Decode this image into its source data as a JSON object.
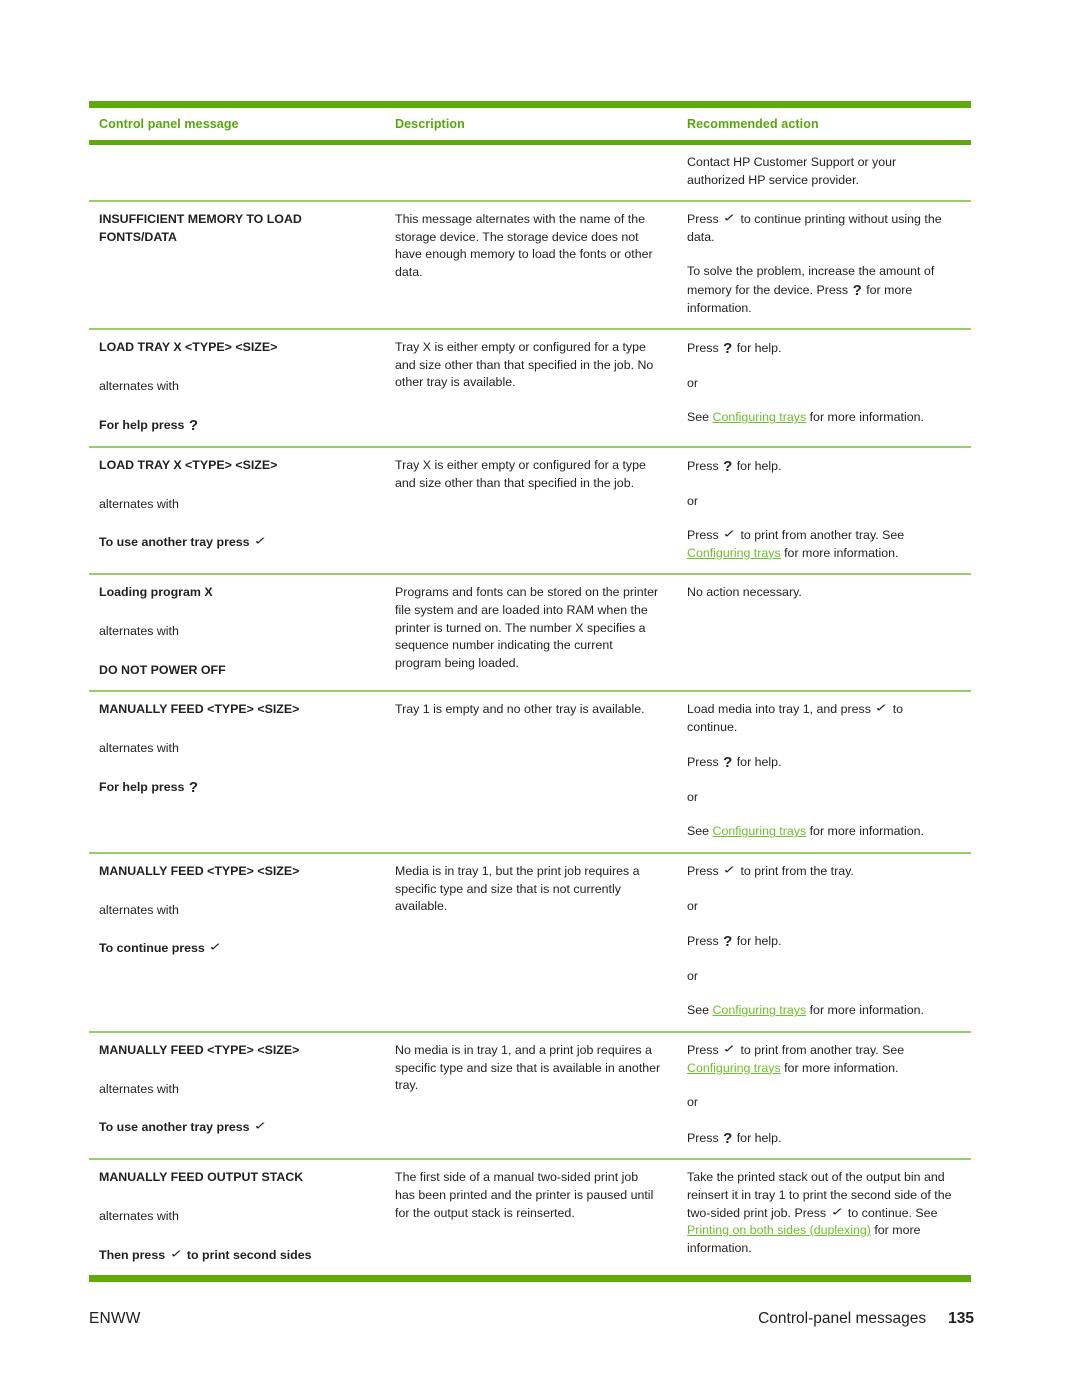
{
  "page": {
    "footer_left": "ENWW",
    "footer_section": "Control-panel messages",
    "footer_page_number": "135"
  },
  "colors": {
    "accent_green": "#5eaa0c",
    "header_text_green": "#58a60c",
    "row_rule_green": "#97cd6b",
    "link_green": "#6fbf2a",
    "body_text": "#231f20"
  },
  "glyphs": {
    "check": "✓",
    "question": "?"
  },
  "table": {
    "headers": {
      "col1": "Control panel message",
      "col2": "Description",
      "col3": "Recommended action"
    },
    "rows": [
      {
        "message_main": "",
        "alternates_label": "",
        "message_second": "",
        "description": [],
        "action": [
          {
            "parts": [
              {
                "t": "Contact HP Customer Support or your authorized HP service provider."
              }
            ]
          }
        ]
      },
      {
        "message_main": "INSUFFICIENT MEMORY TO LOAD FONTS/DATA",
        "alternates_label": "",
        "message_second": "",
        "description": [
          "This message alternates with the name of the storage device. The storage device does not have enough memory to load the fonts or other data."
        ],
        "action": [
          {
            "parts": [
              {
                "t": "Press "
              },
              {
                "icon": "check"
              },
              {
                "t": " to continue printing without using the data."
              }
            ]
          },
          {
            "parts": [
              {
                "t": "To solve the problem, increase the amount of memory for the device. Press "
              },
              {
                "icon": "question"
              },
              {
                "t": " for more information."
              }
            ]
          }
        ]
      },
      {
        "message_main": "LOAD TRAY X <TYPE> <SIZE>",
        "alternates_label": "alternates with",
        "message_second": "For help press ",
        "message_second_icon": "question",
        "description": [
          "Tray X is either empty or configured for a type and size other than that specified in the job. No other tray is available."
        ],
        "action": [
          {
            "parts": [
              {
                "t": "Press "
              },
              {
                "icon": "question"
              },
              {
                "t": " for help."
              }
            ]
          },
          {
            "parts": [
              {
                "t": "or"
              }
            ]
          },
          {
            "parts": [
              {
                "t": "See "
              },
              {
                "link": "Configuring trays"
              },
              {
                "t": " for more information."
              }
            ]
          }
        ]
      },
      {
        "message_main": "LOAD TRAY X <TYPE> <SIZE>",
        "alternates_label": "alternates with",
        "message_second": "To use another tray press ",
        "message_second_icon": "check",
        "description": [
          "Tray X is either empty or configured for a type and size other than that specified in the job."
        ],
        "action": [
          {
            "parts": [
              {
                "t": "Press "
              },
              {
                "icon": "question"
              },
              {
                "t": " for help."
              }
            ]
          },
          {
            "parts": [
              {
                "t": "or"
              }
            ]
          },
          {
            "parts": [
              {
                "t": "Press "
              },
              {
                "icon": "check"
              },
              {
                "t": " to print from another tray. See "
              },
              {
                "link": "Configuring trays"
              },
              {
                "t": " for more information."
              }
            ]
          }
        ]
      },
      {
        "message_main": "Loading program X",
        "alternates_label": "alternates with",
        "message_second": "DO NOT POWER OFF",
        "description": [
          "Programs and fonts can be stored on the printer file system and are loaded into RAM when the printer is turned on. The number X specifies a sequence number indicating the current program being loaded."
        ],
        "action": [
          {
            "parts": [
              {
                "t": "No action necessary."
              }
            ]
          }
        ]
      },
      {
        "message_main": "MANUALLY FEED <TYPE> <SIZE>",
        "alternates_label": "alternates with",
        "message_second": "For help press ",
        "message_second_icon": "question",
        "description": [
          "Tray 1 is empty and no other tray is available."
        ],
        "action": [
          {
            "parts": [
              {
                "t": "Load media into tray 1, and press "
              },
              {
                "icon": "check"
              },
              {
                "t": " to continue."
              }
            ]
          },
          {
            "parts": [
              {
                "t": "Press "
              },
              {
                "icon": "question"
              },
              {
                "t": " for help."
              }
            ]
          },
          {
            "parts": [
              {
                "t": "or"
              }
            ]
          },
          {
            "parts": [
              {
                "t": "See "
              },
              {
                "link": "Configuring trays"
              },
              {
                "t": " for more information."
              }
            ]
          }
        ]
      },
      {
        "message_main": "MANUALLY FEED <TYPE> <SIZE>",
        "alternates_label": "alternates with",
        "message_second": "To continue press ",
        "message_second_icon": "check",
        "description": [
          "Media is in tray 1, but the print job requires a specific type and size that is not currently available."
        ],
        "action": [
          {
            "parts": [
              {
                "t": "Press "
              },
              {
                "icon": "check"
              },
              {
                "t": " to print from the tray."
              }
            ]
          },
          {
            "parts": [
              {
                "t": "or"
              }
            ]
          },
          {
            "parts": [
              {
                "t": "Press "
              },
              {
                "icon": "question"
              },
              {
                "t": " for help."
              }
            ]
          },
          {
            "parts": [
              {
                "t": "or"
              }
            ]
          },
          {
            "parts": [
              {
                "t": "See "
              },
              {
                "link": "Configuring trays"
              },
              {
                "t": " for more information."
              }
            ]
          }
        ]
      },
      {
        "message_main": "MANUALLY FEED <TYPE> <SIZE>",
        "alternates_label": "alternates with",
        "message_second": "To use another tray press ",
        "message_second_icon": "check",
        "description": [
          "No media is in tray 1, and a print job requires a specific type and size that is available in another tray."
        ],
        "action": [
          {
            "parts": [
              {
                "t": "Press "
              },
              {
                "icon": "check"
              },
              {
                "t": " to print from another tray. See "
              },
              {
                "link": "Configuring trays"
              },
              {
                "t": " for more information."
              }
            ]
          },
          {
            "parts": [
              {
                "t": "or"
              }
            ]
          },
          {
            "parts": [
              {
                "t": "Press "
              },
              {
                "icon": "question"
              },
              {
                "t": " for help."
              }
            ]
          }
        ]
      },
      {
        "message_main": "MANUALLY FEED OUTPUT STACK",
        "alternates_label": "alternates with",
        "message_second": "Then press ",
        "message_second_icon": "check",
        "message_second_tail": " to print second sides",
        "description": [
          "The first side of a manual two-sided print job has been printed and the printer is paused until for the output stack is reinserted."
        ],
        "action": [
          {
            "parts": [
              {
                "t": "Take the printed stack out of the output bin and reinsert it in tray 1 to print the second side of the two-sided print job. Press "
              },
              {
                "icon": "check"
              },
              {
                "t": " to continue. See "
              },
              {
                "link": "Printing on both sides (duplexing)"
              },
              {
                "t": " for more information."
              }
            ]
          }
        ]
      }
    ]
  }
}
